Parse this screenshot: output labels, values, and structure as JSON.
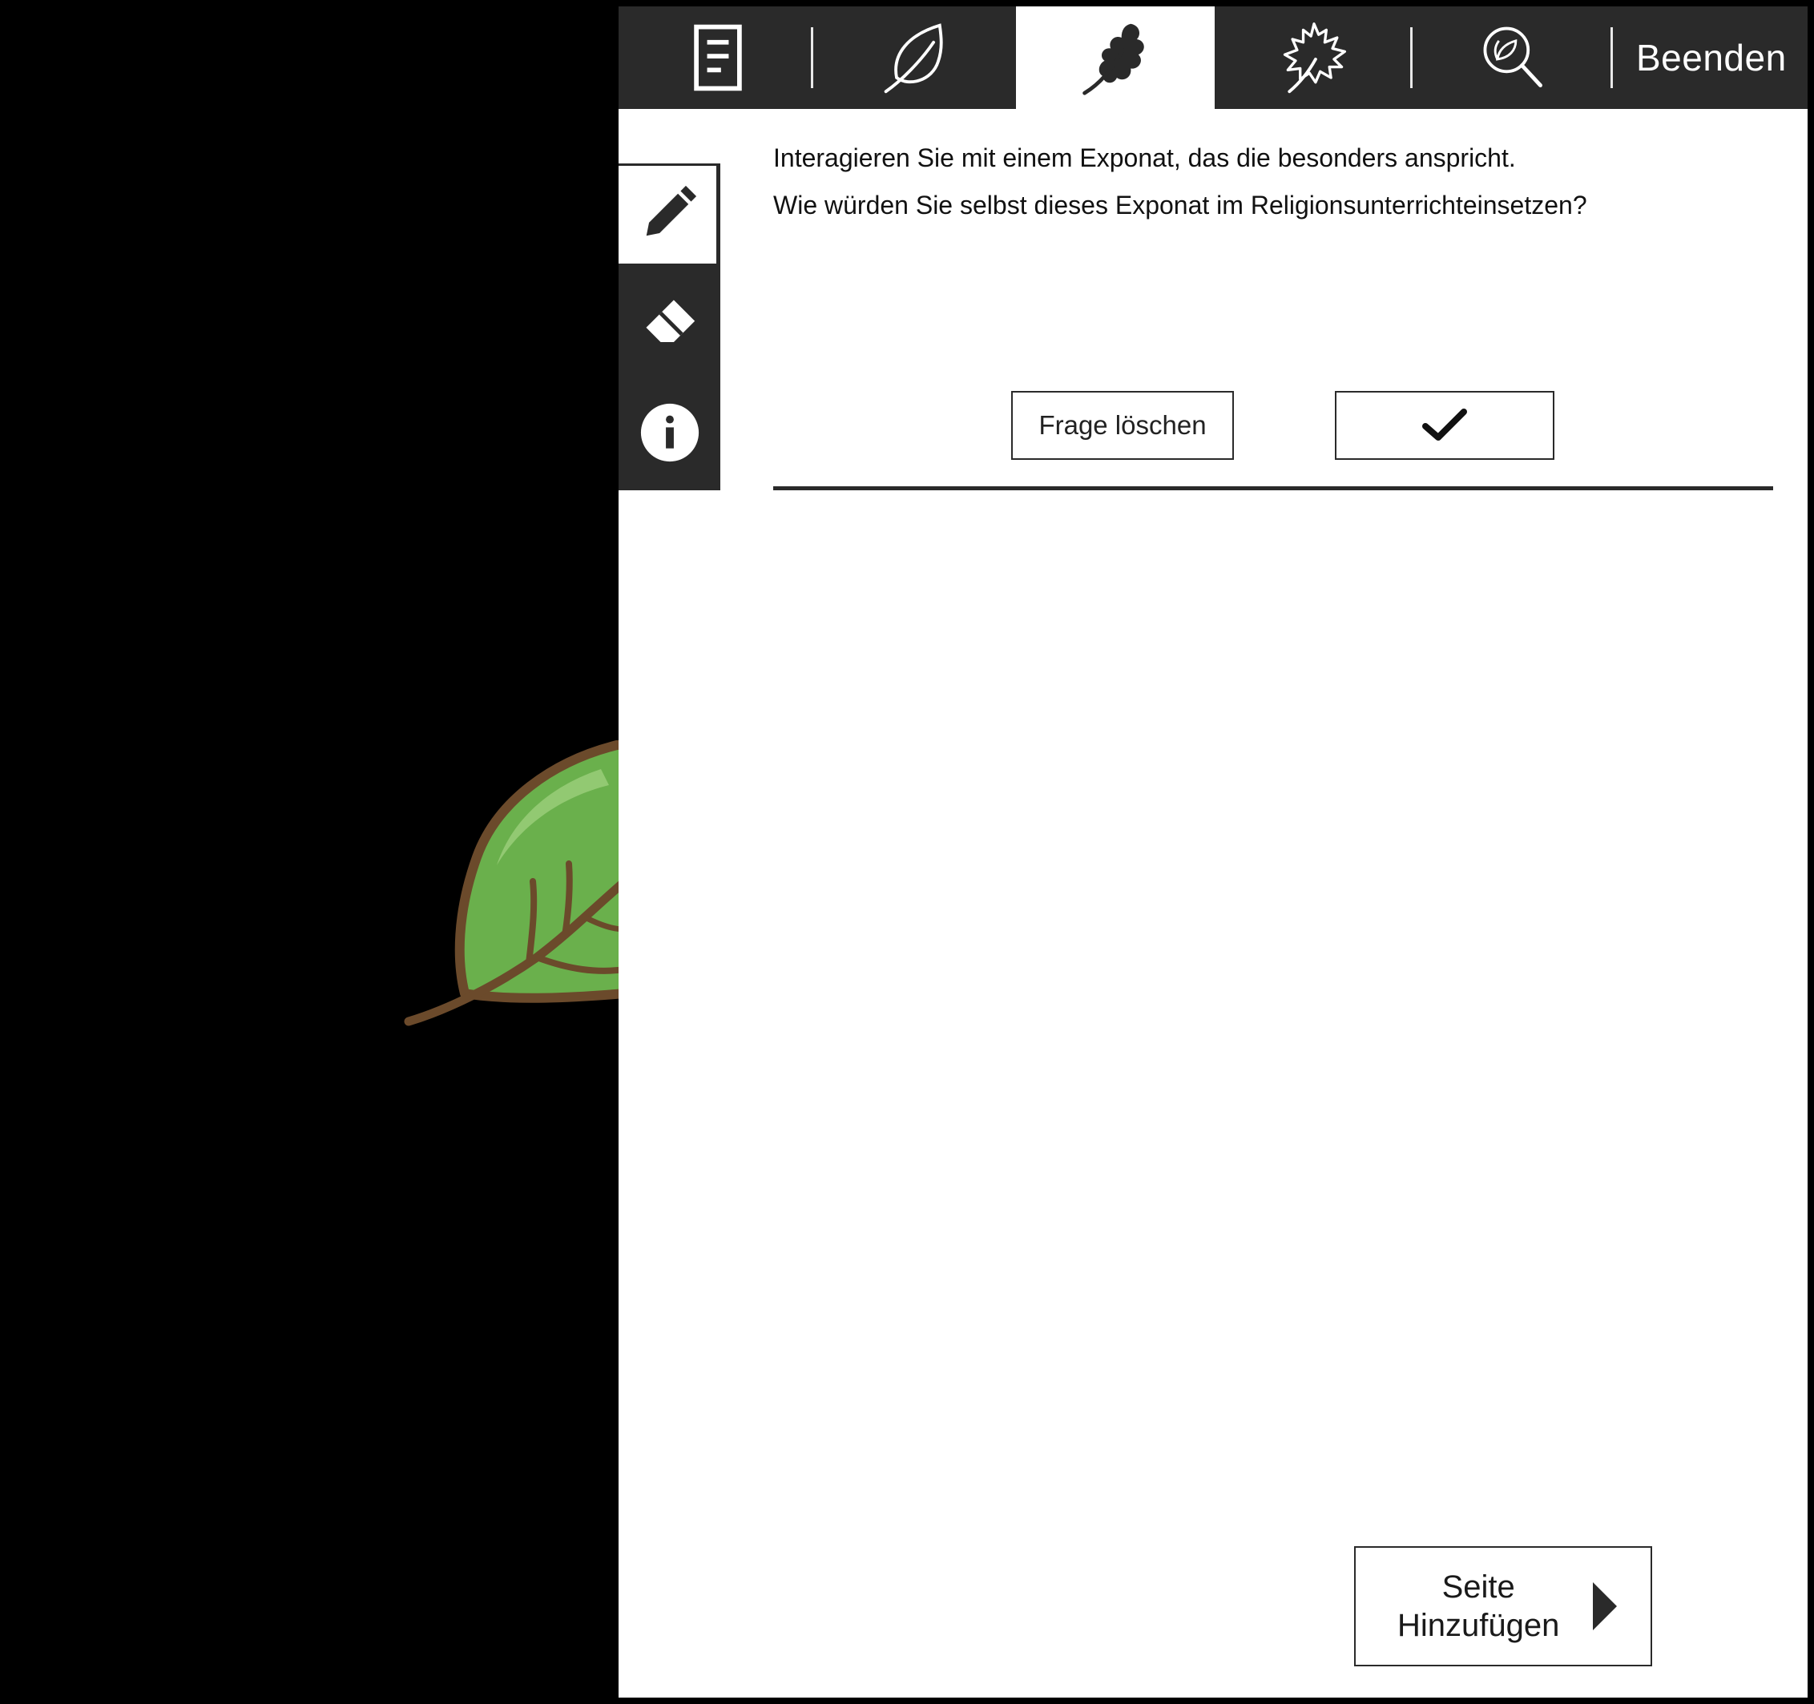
{
  "topbar": {
    "tabs": [
      {
        "icon": "document-icon",
        "active": false
      },
      {
        "icon": "smooth-leaf-icon",
        "active": false
      },
      {
        "icon": "oak-leaf-icon",
        "active": true
      },
      {
        "icon": "maple-leaf-icon",
        "active": false
      },
      {
        "icon": "magnifier-leaf-icon",
        "active": false
      }
    ],
    "end_label": "Beenden"
  },
  "tools": [
    {
      "icon": "pencil-icon",
      "active": true
    },
    {
      "icon": "eraser-icon",
      "active": false
    },
    {
      "icon": "info-icon",
      "active": false
    }
  ],
  "question": {
    "line1": "Interagieren Sie mit einem Exponat, das die besonders anspricht.",
    "line2": "Wie würden Sie selbst dieses Exponat im Religionsunterrichteinsetzen?"
  },
  "actions": {
    "delete_label": "Frage löschen",
    "confirm_icon": "checkmark-icon"
  },
  "footer": {
    "add_page_label": "Seite\nHinzufügen",
    "add_page_icon": "triangle-right-icon"
  },
  "colors": {
    "background": "#000000",
    "panel": "#ffffff",
    "bar": "#2a2a2a",
    "leaf_green": "#6ab04c",
    "leaf_stem": "#6b4a2b"
  }
}
